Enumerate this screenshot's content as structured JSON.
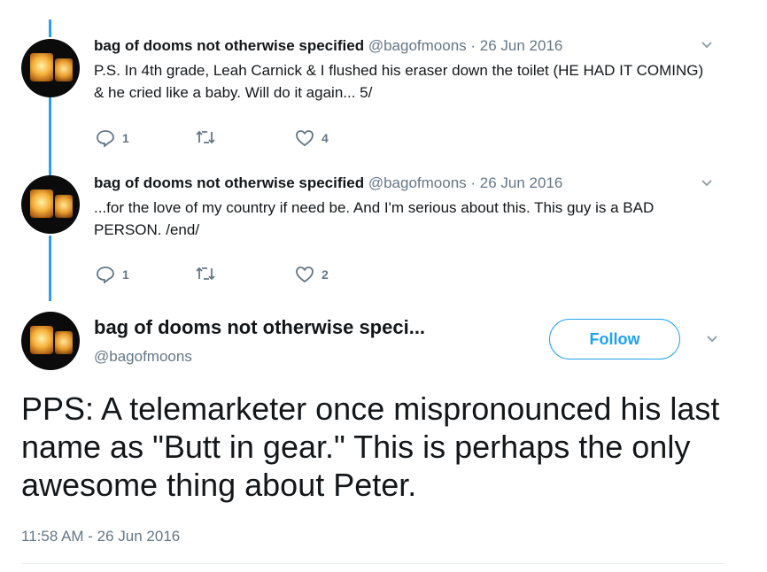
{
  "tweets": [
    {
      "name": "bag of dooms not otherwise specified",
      "handle": "@bagofmoons",
      "date": "· 26 Jun 2016",
      "text": "P.S. In 4th grade, Leah Carnick & I flushed his eraser down the toilet (HE HAD IT COMING) & he cried like a baby. Will do it again... 5/",
      "replies": "1",
      "retweets": "",
      "likes": "4"
    },
    {
      "name": "bag of dooms not otherwise specified",
      "handle": "@bagofmoons",
      "date": "· 26 Jun 2016",
      "text": "...for the love of my country if need be. And I'm serious about this. This guy is a BAD PERSON. /end/",
      "replies": "1",
      "retweets": "",
      "likes": "2"
    }
  ],
  "main_tweet": {
    "name": "bag of dooms not otherwise speci...",
    "handle": "@bagofmoons",
    "follow_label": "Follow",
    "text": "PPS: A telemarketer once mispronounced his last name as \"Butt in gear.\" This is perhaps the only awesome thing about Peter.",
    "timestamp": "11:58 AM - 26 Jun 2016"
  },
  "colors": {
    "thread_line": "#2a9df4",
    "follow_accent": "#1da1f2",
    "muted": "#657786"
  },
  "icons": [
    "reply-icon",
    "retweet-icon",
    "like-icon",
    "chevron-down-icon",
    "avatar-lantern-image"
  ]
}
